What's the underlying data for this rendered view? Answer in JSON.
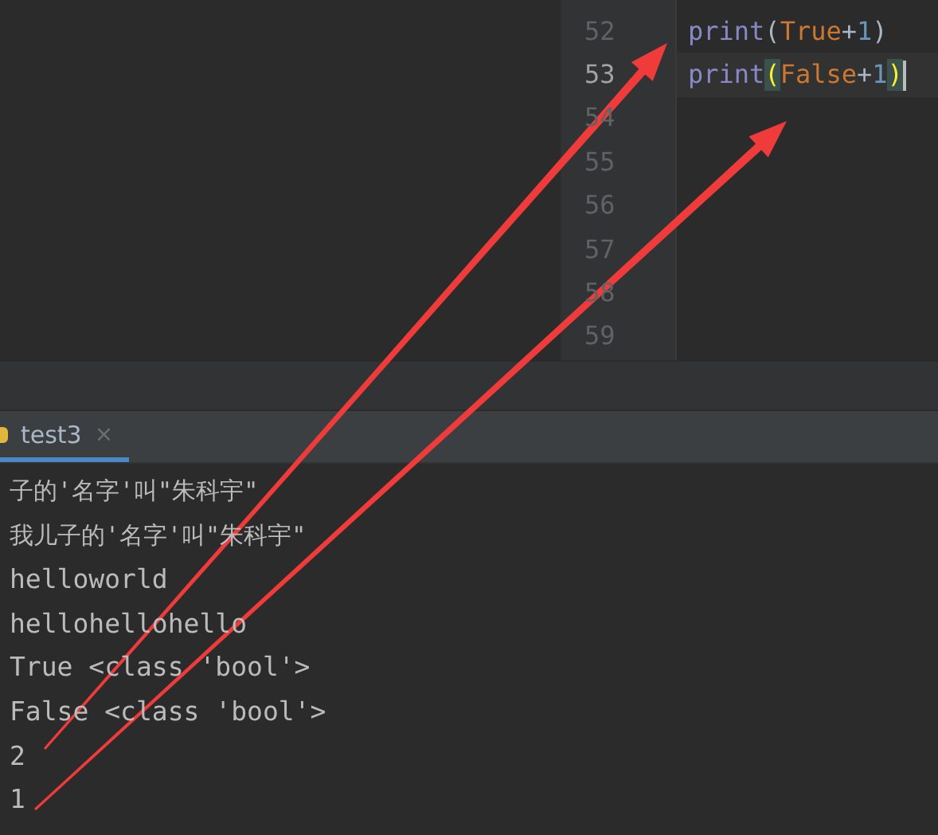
{
  "editor": {
    "lines": [
      {
        "number": "52",
        "current": false,
        "caret": false,
        "tokens": [
          {
            "text": "print",
            "kind": "function",
            "matched": false
          },
          {
            "text": "(",
            "kind": "paren",
            "matched": false
          },
          {
            "text": "True",
            "kind": "keyword",
            "matched": false
          },
          {
            "text": "+",
            "kind": "operator",
            "matched": false
          },
          {
            "text": "1",
            "kind": "number",
            "matched": false
          },
          {
            "text": ")",
            "kind": "paren",
            "matched": false
          }
        ]
      },
      {
        "number": "53",
        "current": true,
        "caret": true,
        "tokens": [
          {
            "text": "print",
            "kind": "function",
            "matched": false
          },
          {
            "text": "(",
            "kind": "paren",
            "matched": true
          },
          {
            "text": "False",
            "kind": "keyword",
            "matched": false
          },
          {
            "text": "+",
            "kind": "operator",
            "matched": false
          },
          {
            "text": "1",
            "kind": "number",
            "matched": false
          },
          {
            "text": ")",
            "kind": "paren",
            "matched": true
          }
        ]
      },
      {
        "number": "54",
        "current": false,
        "caret": false
      },
      {
        "number": "55",
        "current": false,
        "caret": false
      },
      {
        "number": "56",
        "current": false,
        "caret": false
      },
      {
        "number": "57",
        "current": false,
        "caret": false
      },
      {
        "number": "58",
        "current": false,
        "caret": false
      },
      {
        "number": "59",
        "current": false,
        "caret": false
      }
    ]
  },
  "run_panel": {
    "tabs": [
      {
        "label": "test3",
        "selected": true,
        "close": "×"
      }
    ],
    "output": [
      "子的'名字'叫\"朱科宇\"",
      "我儿子的'名字'叫\"朱科宇\"",
      "helloworld",
      "hellohellohello",
      "True <class 'bool'>",
      "False <class 'bool'>",
      "2",
      "1"
    ]
  }
}
